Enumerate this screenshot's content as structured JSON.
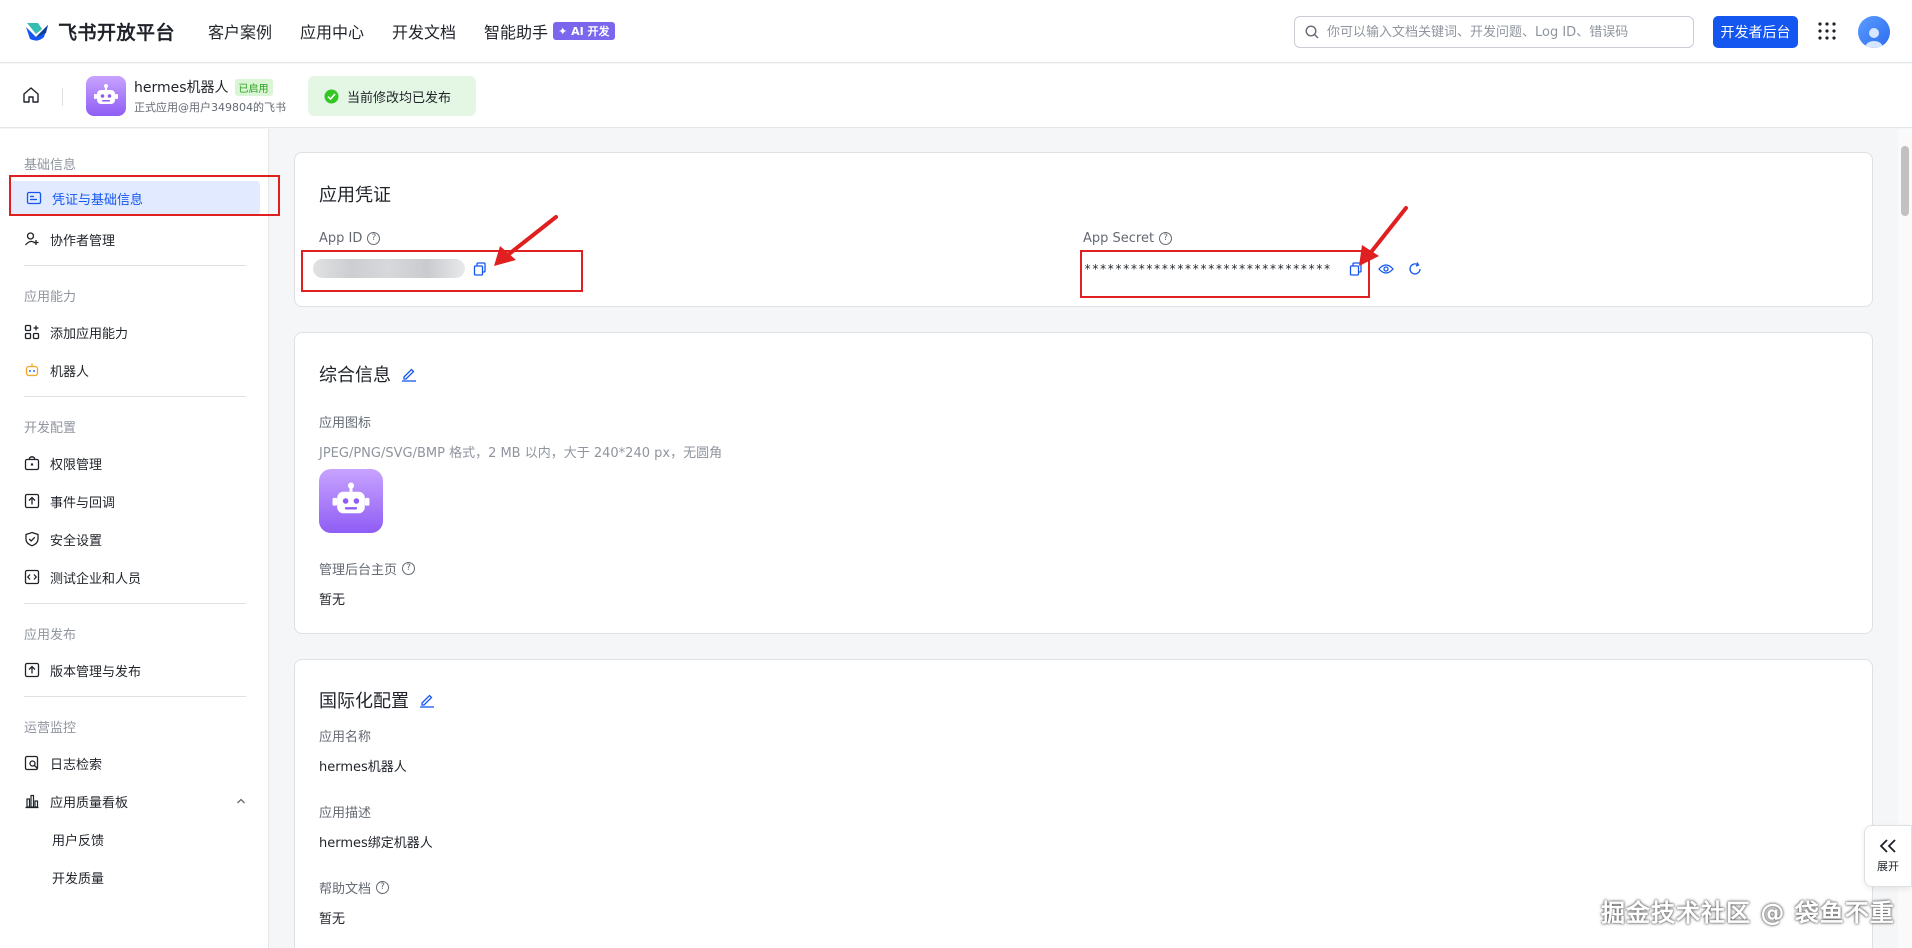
{
  "topbar": {
    "logo_text": "飞书开放平台",
    "nav": [
      "客户案例",
      "应用中心",
      "开发文档",
      "智能助手"
    ],
    "ai_badge": "✦ AI 开发",
    "search_placeholder": "你可以输入文档关键词、开发问题、Log ID、错误码",
    "dev_console": "开发者后台"
  },
  "app_header": {
    "name": "hermes机器人",
    "status_badge": "已启用",
    "subtitle": "正式应用@用户349804的飞书",
    "publish_status": "当前修改均已发布"
  },
  "sidebar": {
    "groups": [
      {
        "title": "基础信息",
        "items": [
          "凭证与基础信息",
          "协作者管理"
        ]
      },
      {
        "title": "应用能力",
        "items": [
          "添加应用能力",
          "机器人"
        ]
      },
      {
        "title": "开发配置",
        "items": [
          "权限管理",
          "事件与回调",
          "安全设置",
          "测试企业和人员"
        ]
      },
      {
        "title": "应用发布",
        "items": [
          "版本管理与发布"
        ]
      },
      {
        "title": "运营监控",
        "items": [
          "日志检索",
          "应用质量看板",
          "用户反馈",
          "开发质量"
        ]
      }
    ],
    "active_item": "凭证与基础信息"
  },
  "credentials": {
    "title": "应用凭证",
    "app_id_label": "App ID",
    "app_secret_label": "App Secret",
    "app_secret_masked": "********************************"
  },
  "general": {
    "title": "综合信息",
    "icon_label": "应用图标",
    "icon_hint": "JPEG/PNG/SVG/BMP 格式，2 MB 以内，大于 240*240 px，无圆角",
    "admin_home_label": "管理后台主页",
    "admin_home_value": "暂无"
  },
  "i18n": {
    "title": "国际化配置",
    "name_label": "应用名称",
    "name_value": "hermes机器人",
    "desc_label": "应用描述",
    "desc_value": "hermes绑定机器人",
    "help_label": "帮助文档",
    "help_value": "暂无"
  },
  "expand_label": "展开",
  "watermark": "掘金技术社区 @ 袋鱼不重",
  "colors": {
    "primary": "#1456f0",
    "annotation_red": "#e02020",
    "success_bg": "#e4f7e5",
    "app_icon_purple": "#8f5df5"
  }
}
